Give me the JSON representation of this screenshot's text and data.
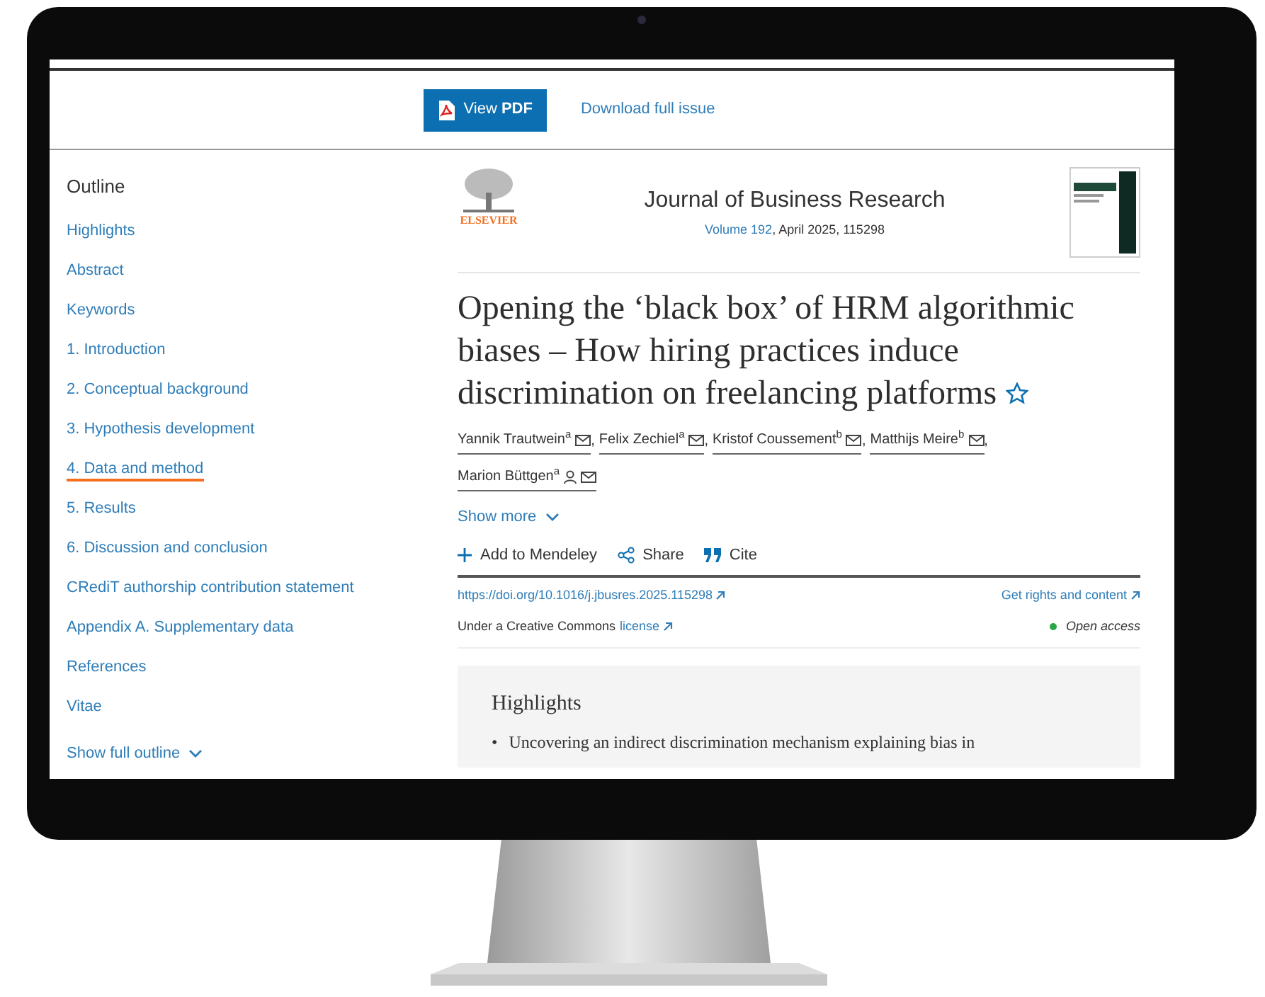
{
  "toolbar": {
    "view_pdf": "View **PDF**",
    "download": "Download full issue"
  },
  "outline": {
    "title": "Outline",
    "items": [
      {
        "label": "Highlights",
        "selected": false
      },
      {
        "label": "Abstract",
        "selected": false
      },
      {
        "label": "Keywords",
        "selected": false
      },
      {
        "label": "1. Introduction",
        "selected": false
      },
      {
        "label": "2. Conceptual background",
        "selected": false
      },
      {
        "label": "3. Hypothesis development",
        "selected": false
      },
      {
        "label": "4. Data and method",
        "selected": true
      },
      {
        "label": "5. Results",
        "selected": false
      },
      {
        "label": "6. Discussion and conclusion",
        "selected": false
      },
      {
        "label": "CRediT authorship contribution statement",
        "selected": false
      },
      {
        "label": "Appendix A. Supplementary data",
        "selected": false
      },
      {
        "label": "References",
        "selected": false
      },
      {
        "label": "Vitae",
        "selected": false
      }
    ],
    "show_full": "Show full outline"
  },
  "journal": {
    "publisher": "ELSEVIER",
    "name": "Journal of Business Research",
    "volume": "Volume 192",
    "details": ", April 2025, 115298"
  },
  "article": {
    "title": "Opening the ‘black box’ of HRM algorithmic biases – How hiring practices induce discrimination on freelancing platforms",
    "authors": [
      {
        "name": "Yannik Trautwein",
        "sup": "a",
        "corresponding": false
      },
      {
        "name": "Felix Zechiel",
        "sup": "a",
        "corresponding": false
      },
      {
        "name": "Kristof Coussement",
        "sup": "b",
        "corresponding": false
      },
      {
        "name": "Matthijs Meire",
        "sup": "b",
        "corresponding": false
      },
      {
        "name": "Marion Büttgen",
        "sup": "a",
        "corresponding": true
      }
    ],
    "author_separator": ",",
    "show_more": "Show more",
    "actions": [
      {
        "kind": "add",
        "label": "Add to Mendeley"
      },
      {
        "kind": "share",
        "label": "Share"
      },
      {
        "kind": "cite",
        "label": "Cite"
      }
    ],
    "doi": "https://doi.org/10.1016/j.jbusres.2025.115298",
    "rights": "Get rights and content",
    "license_text": "Under a Creative Commons",
    "license_link": "license",
    "access": "Open access"
  },
  "highlights": {
    "heading": "Highlights",
    "marker": "•",
    "bullets": [
      "Uncovering an indirect discrimination mechanism explaining bias in"
    ]
  }
}
